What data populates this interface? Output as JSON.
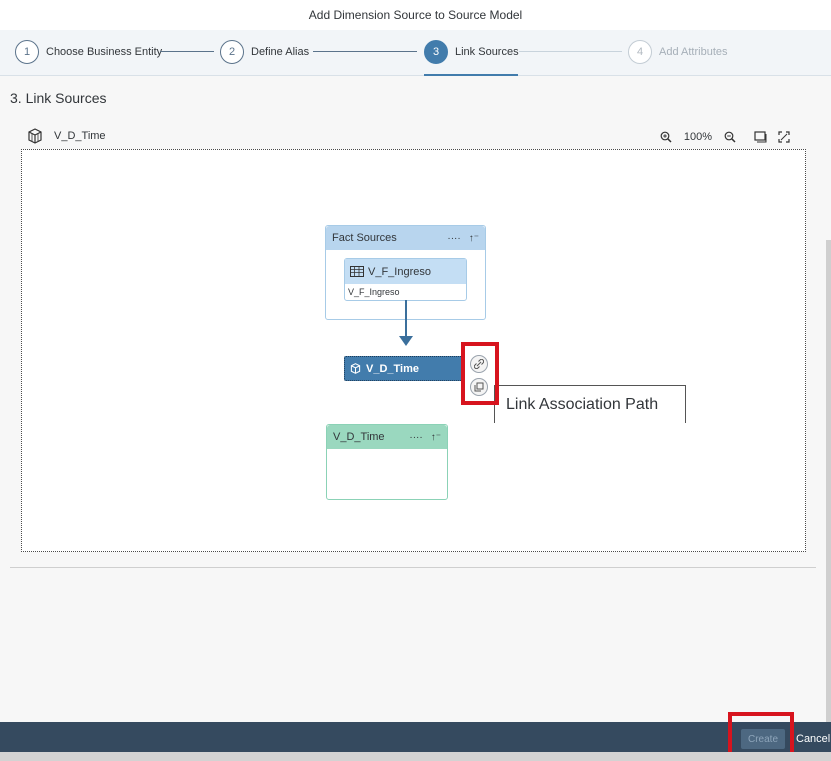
{
  "dialog": {
    "title": "Add Dimension Source to Source Model"
  },
  "wizard": {
    "steps": [
      {
        "number": "1",
        "label": "Choose Business Entity",
        "state": "completed"
      },
      {
        "number": "2",
        "label": "Define Alias",
        "state": "completed"
      },
      {
        "number": "3",
        "label": "Link Sources",
        "state": "active"
      },
      {
        "number": "4",
        "label": "Add Attributes",
        "state": "disabled"
      }
    ]
  },
  "section": {
    "title": "3. Link Sources"
  },
  "canvas": {
    "entity_name": "V_D_Time",
    "zoom": "100%",
    "fact_sources": {
      "title": "Fact Sources",
      "more": "····",
      "sort": "↑⁻",
      "entity": {
        "name": "V_F_Ingreso",
        "subtitle": "V_F_Ingreso"
      }
    },
    "selected_dimension": {
      "name": "V_D_Time"
    },
    "dimension_node": {
      "title": "V_D_Time",
      "more": "····",
      "sort": "↑⁻"
    },
    "tooltip": "Link Association Path"
  },
  "footer": {
    "create_label": "Create",
    "cancel_label": "Cancel"
  },
  "colors": {
    "accent": "#427cac",
    "footer": "#354a5f",
    "highlight": "#d7141e",
    "dimension_header": "#9ad8bf",
    "fact_header": "#b8d5ee"
  }
}
